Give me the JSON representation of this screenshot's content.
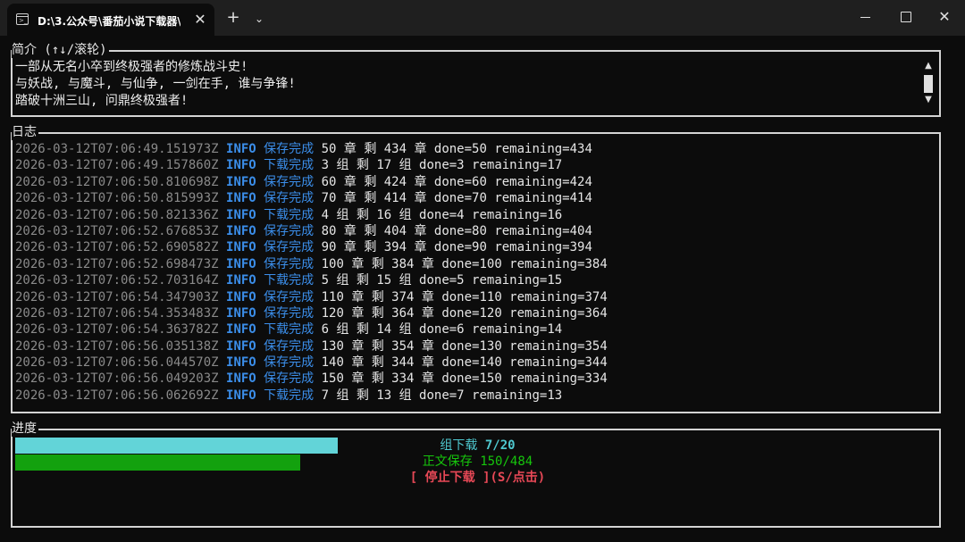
{
  "window": {
    "tab_title": "D:\\3.公众号\\番茄小说下载器\\",
    "tab_icon_glyph": ">_",
    "close_tab_glyph": "✕",
    "new_tab_glyph": "+",
    "dropdown_glyph": "⌄",
    "close_window_glyph": "✕"
  },
  "intro": {
    "label": "简介 (↑↓/滚轮)",
    "lines": [
      "一部从无名小卒到终极强者的修炼战斗史!",
      "与妖战, 与魔斗, 与仙争, 一剑在手, 谁与争锋!",
      "踏破十洲三山, 问鼎终极强者!"
    ],
    "scroll_up_glyph": "▲",
    "scroll_down_glyph": "▼"
  },
  "log": {
    "label": "日志",
    "entries": [
      {
        "ts": "2026-03-12T07:06:49.151973Z",
        "level": "INFO",
        "event": "保存完成",
        "msg": "50 章 剩 434 章 done=50 remaining=434"
      },
      {
        "ts": "2026-03-12T07:06:49.157860Z",
        "level": "INFO",
        "event": "下载完成",
        "msg": "3 组 剩 17 组 done=3 remaining=17"
      },
      {
        "ts": "2026-03-12T07:06:50.810698Z",
        "level": "INFO",
        "event": "保存完成",
        "msg": "60 章 剩 424 章 done=60 remaining=424"
      },
      {
        "ts": "2026-03-12T07:06:50.815993Z",
        "level": "INFO",
        "event": "保存完成",
        "msg": "70 章 剩 414 章 done=70 remaining=414"
      },
      {
        "ts": "2026-03-12T07:06:50.821336Z",
        "level": "INFO",
        "event": "下载完成",
        "msg": "4 组 剩 16 组 done=4 remaining=16"
      },
      {
        "ts": "2026-03-12T07:06:52.676853Z",
        "level": "INFO",
        "event": "保存完成",
        "msg": "80 章 剩 404 章 done=80 remaining=404"
      },
      {
        "ts": "2026-03-12T07:06:52.690582Z",
        "level": "INFO",
        "event": "保存完成",
        "msg": "90 章 剩 394 章 done=90 remaining=394"
      },
      {
        "ts": "2026-03-12T07:06:52.698473Z",
        "level": "INFO",
        "event": "保存完成",
        "msg": "100 章 剩 384 章 done=100 remaining=384"
      },
      {
        "ts": "2026-03-12T07:06:52.703164Z",
        "level": "INFO",
        "event": "下载完成",
        "msg": "5 组 剩 15 组 done=5 remaining=15"
      },
      {
        "ts": "2026-03-12T07:06:54.347903Z",
        "level": "INFO",
        "event": "保存完成",
        "msg": "110 章 剩 374 章 done=110 remaining=374"
      },
      {
        "ts": "2026-03-12T07:06:54.353483Z",
        "level": "INFO",
        "event": "保存完成",
        "msg": "120 章 剩 364 章 done=120 remaining=364"
      },
      {
        "ts": "2026-03-12T07:06:54.363782Z",
        "level": "INFO",
        "event": "下载完成",
        "msg": "6 组 剩 14 组 done=6 remaining=14"
      },
      {
        "ts": "2026-03-12T07:06:56.035138Z",
        "level": "INFO",
        "event": "保存完成",
        "msg": "130 章 剩 354 章 done=130 remaining=354"
      },
      {
        "ts": "2026-03-12T07:06:56.044570Z",
        "level": "INFO",
        "event": "保存完成",
        "msg": "140 章 剩 344 章 done=140 remaining=344"
      },
      {
        "ts": "2026-03-12T07:06:56.049203Z",
        "level": "INFO",
        "event": "保存完成",
        "msg": "150 章 剩 334 章 done=150 remaining=334"
      },
      {
        "ts": "2026-03-12T07:06:56.062692Z",
        "level": "INFO",
        "event": "下载完成",
        "msg": "7 组 剩 13 组 done=7 remaining=13"
      }
    ]
  },
  "progress": {
    "label": "进度",
    "groups": {
      "label": "组下载",
      "value": "7/20",
      "fraction": 0.35,
      "color": "#62d4d8"
    },
    "save": {
      "label": "正文保存",
      "value": "150/484",
      "fraction": 0.31,
      "color": "#13a10e"
    },
    "stop_label": "[ 停止下载 ](S/点击)"
  },
  "colors": {
    "background": "#0c0c0c",
    "info": "#3b8eea",
    "timestamp": "#8a8a8a",
    "stop": "#e74856"
  }
}
